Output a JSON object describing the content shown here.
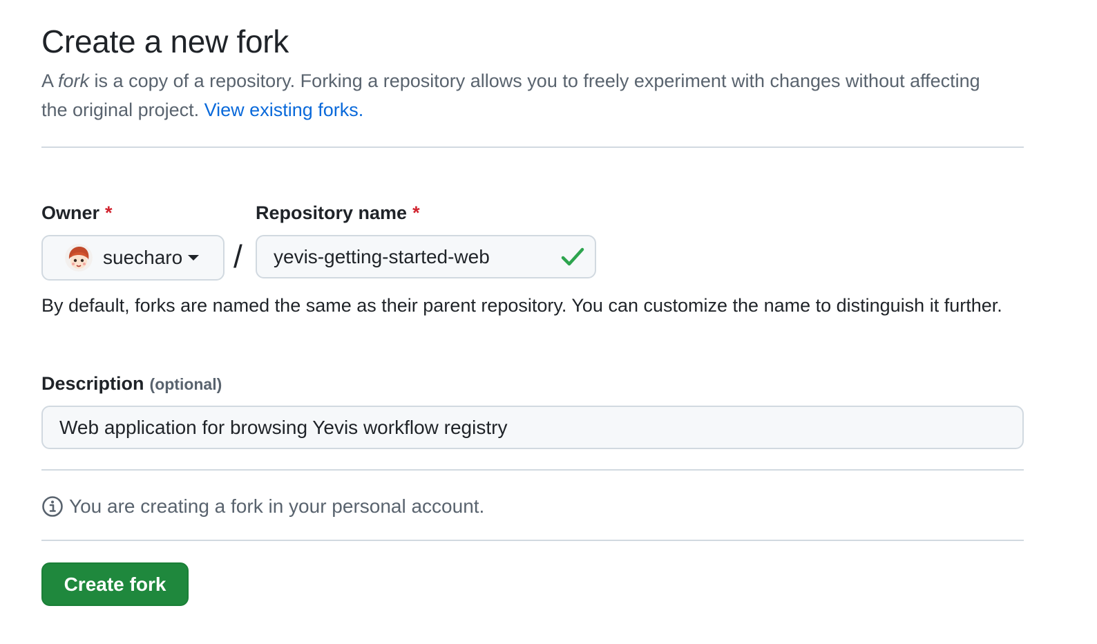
{
  "header": {
    "title": "Create a new fork",
    "intro_prefix": "A ",
    "intro_em": "fork",
    "intro_rest": " is a copy of a repository. Forking a repository allows you to freely experiment with changes without affecting the original project. ",
    "view_forks_link": "View existing forks."
  },
  "form": {
    "owner_label": "Owner",
    "required_marker": "*",
    "owner_value": "suecharo",
    "owner_icon": "user-avatar",
    "separator": "/",
    "repo_label": "Repository name",
    "repo_value": "yevis-getting-started-web",
    "repo_status_icon": "check-icon",
    "help_text": "By default, forks are named the same as their parent repository. You can customize the name to distinguish it further.",
    "description_label": "Description",
    "description_optional": "(optional)",
    "description_value": "Web application for browsing Yevis workflow registry"
  },
  "notice": {
    "icon": "info-icon",
    "text": "You are creating a fork in your personal account."
  },
  "actions": {
    "create_label": "Create fork"
  },
  "colors": {
    "link": "#0969da",
    "required": "#d1242f",
    "success_check": "#2da44e",
    "primary_button": "#1f883d",
    "muted_text": "#59636e",
    "border": "#d1d9e0",
    "input_bg": "#f6f8fa"
  }
}
